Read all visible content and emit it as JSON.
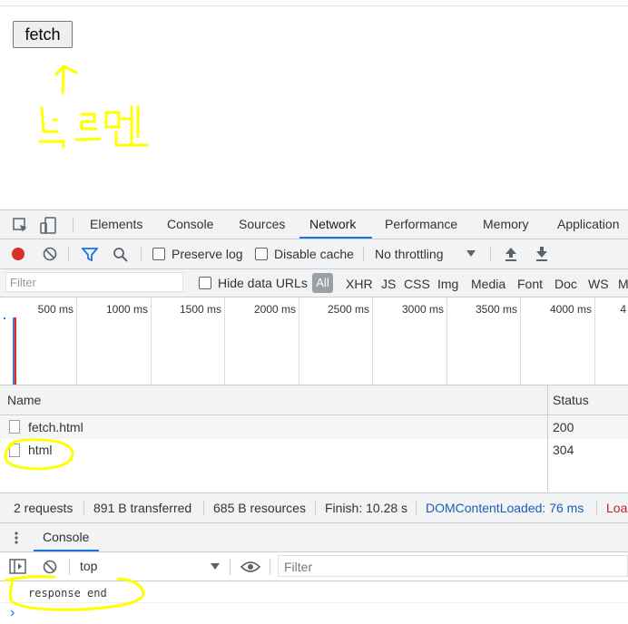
{
  "page": {
    "fetch_button_label": "fetch"
  },
  "annotation": {
    "handwriting": "누르면"
  },
  "devtools": {
    "tabs": [
      "Elements",
      "Console",
      "Sources",
      "Network",
      "Performance",
      "Memory",
      "Application"
    ],
    "active_tab": "Network",
    "toolbar": {
      "preserve_log": "Preserve log",
      "disable_cache": "Disable cache",
      "throttling": "No throttling"
    },
    "filter": {
      "placeholder": "Filter",
      "hide_data_urls": "Hide data URLs",
      "types": [
        "All",
        "XHR",
        "JS",
        "CSS",
        "Img",
        "Media",
        "Font",
        "Doc",
        "WS",
        "M"
      ]
    },
    "timeline_ticks": [
      "500 ms",
      "1000 ms",
      "1500 ms",
      "2000 ms",
      "2500 ms",
      "3000 ms",
      "3500 ms",
      "4000 ms",
      "4"
    ],
    "table": {
      "headers": {
        "name": "Name",
        "status": "Status"
      },
      "rows": [
        {
          "name": "fetch.html",
          "status": "200"
        },
        {
          "name": "html",
          "status": "304"
        }
      ]
    },
    "summary": {
      "requests": "2 requests",
      "transferred": "891 B transferred",
      "resources": "685 B resources",
      "finish": "Finish: 10.28 s",
      "domcontentloaded": "DOMContentLoaded: 76 ms",
      "load": "Load"
    },
    "drawer": {
      "tab": "Console",
      "context": "top",
      "filter_placeholder": "Filter",
      "messages": [
        "response end"
      ],
      "prompt": "›"
    },
    "colors": {
      "accent": "#1a73e8",
      "record": "#d93025",
      "highlight": "#ffff00"
    }
  }
}
